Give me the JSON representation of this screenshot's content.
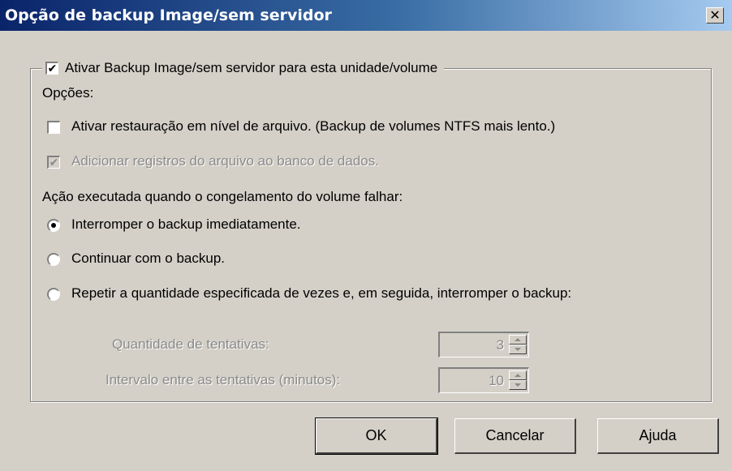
{
  "window": {
    "title": "Opção de backup Image/sem servidor",
    "close_symbol": "✕",
    "close_icon": "close-icon"
  },
  "group": {
    "checkbox_label": "Ativar Backup Image/sem servidor para esta unidade/volume",
    "checked": true
  },
  "options": {
    "heading": "Opções:",
    "file_level_restore": {
      "label": "Ativar restauração em nível de arquivo. (Backup de volumes NTFS mais lento.)",
      "checked": false
    },
    "add_file_records": {
      "label": "Adicionar registros do arquivo ao banco de dados.",
      "checked": true,
      "disabled": true
    }
  },
  "freeze_action": {
    "heading": "Ação executada quando o congelamento do volume falhar:",
    "selected_index": 0,
    "choices": [
      {
        "label": "Interromper o backup imediatamente."
      },
      {
        "label": "Continuar com o backup."
      },
      {
        "label": "Repetir a quantidade especificada de vezes e, em seguida, interromper o backup:"
      }
    ]
  },
  "retry": {
    "count_label": "Quantidade de tentativas:",
    "count_value": "3",
    "interval_label": "Intervalo entre as tentativas (minutos):",
    "interval_value": "10",
    "disabled": true
  },
  "buttons": {
    "ok": "OK",
    "cancel": "Cancelar",
    "help": "Ajuda"
  },
  "glyphs": {
    "checkmark": "✔"
  },
  "colors": {
    "title_gradient_start": "#0a246a",
    "title_gradient_end": "#a6caf0",
    "face": "#d4d0c8",
    "disabled_text": "#8a8a8a"
  }
}
